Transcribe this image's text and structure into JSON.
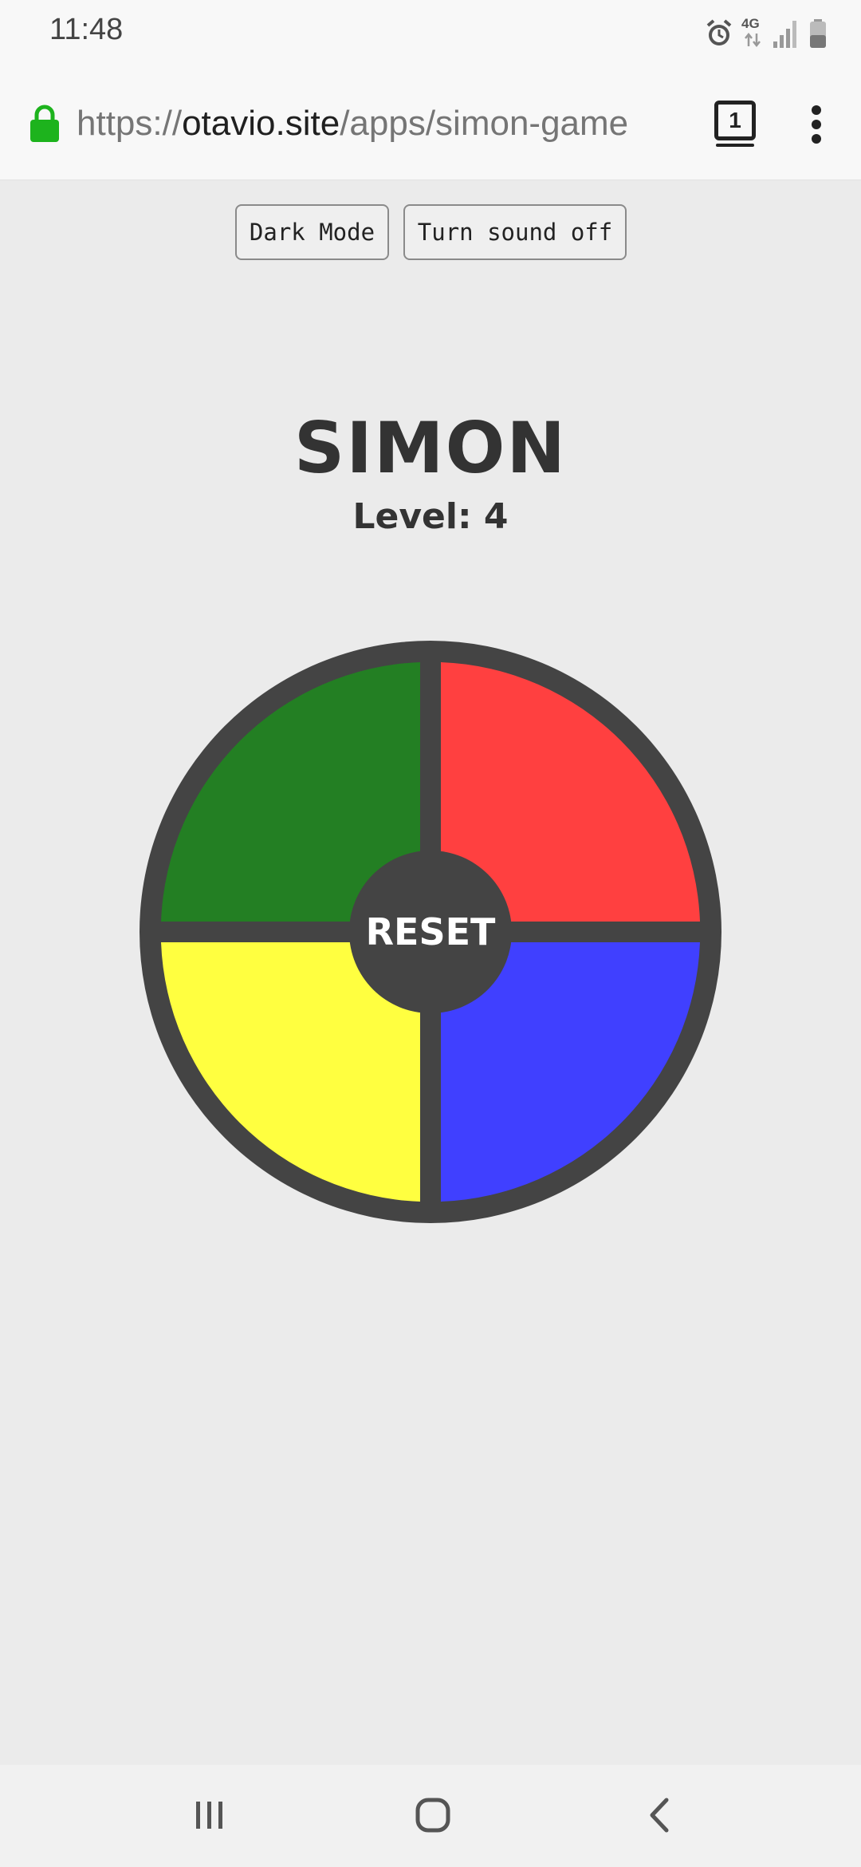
{
  "status_bar": {
    "time": "11:48",
    "network": "4G",
    "icons": [
      "alarm-icon",
      "network-4g-icon",
      "signal-icon",
      "battery-icon"
    ]
  },
  "browser": {
    "url_scheme": "https://",
    "url_host": "otavio.site",
    "url_path": "/apps/simon-game",
    "tab_count": "1",
    "icons": [
      "lock-icon",
      "tabs-icon",
      "overflow-menu-icon"
    ],
    "lock_color": "#1db31d"
  },
  "controls": {
    "dark_mode_label": "Dark Mode",
    "sound_label": "Turn sound off"
  },
  "game": {
    "title": "SIMON",
    "level_label": "Level: 4",
    "reset_label": "RESET",
    "pads": [
      {
        "name": "green",
        "color": "#237f23"
      },
      {
        "name": "red",
        "color": "#ff4040"
      },
      {
        "name": "yellow",
        "color": "#ffff40"
      },
      {
        "name": "blue",
        "color": "#4040ff"
      }
    ],
    "board_color": "#444444",
    "background_color": "#ebebeb"
  },
  "navigation": {
    "icons": [
      "recent-apps-icon",
      "home-icon",
      "back-icon"
    ]
  }
}
